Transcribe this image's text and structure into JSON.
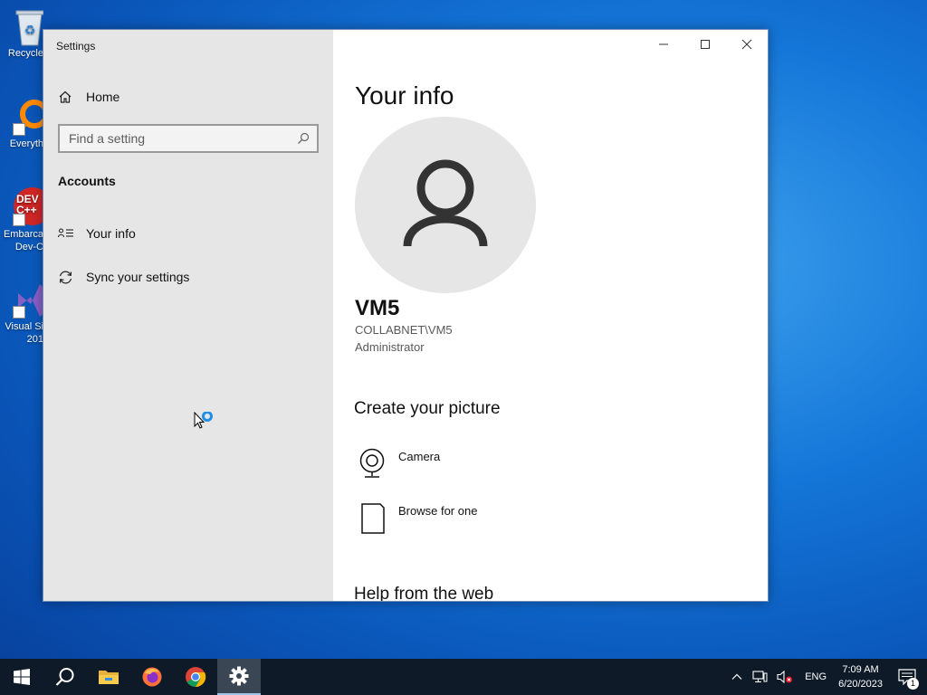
{
  "desktop": {
    "icons": [
      {
        "label": "Recycle",
        "icon": "recycle-bin-icon"
      },
      {
        "label": "Everyth",
        "icon": "everything-search-icon"
      },
      {
        "label": "Embarca",
        "label2": "Dev-C",
        "icon": "dev-cpp-icon"
      },
      {
        "label": "Visual Si",
        "label2": "201",
        "icon": "visual-studio-icon"
      }
    ],
    "devcpp_text": "DEV C++"
  },
  "window": {
    "title": "Settings",
    "controls": [
      "minimize-icon",
      "maximize-icon",
      "close-icon"
    ]
  },
  "nav": {
    "home_label": "Home",
    "search_placeholder": "Find a setting",
    "section_label": "Accounts",
    "items": [
      {
        "label": "Your info",
        "icon": "person-card-icon"
      },
      {
        "label": "Sync your settings",
        "icon": "sync-icon"
      }
    ]
  },
  "content": {
    "title": "Your info",
    "user_name": "VM5",
    "user_domain": "COLLABNET\\VM5",
    "user_role": "Administrator",
    "create_picture_header": "Create your picture",
    "options": [
      {
        "label": "Camera",
        "icon": "camera-icon"
      },
      {
        "label": "Browse for one",
        "icon": "document-icon"
      }
    ],
    "help_header": "Help from the web"
  },
  "taskbar": {
    "apps": [
      "start-icon",
      "search-icon",
      "file-explorer-icon",
      "firefox-icon",
      "chrome-icon",
      "settings-icon"
    ],
    "active_app": "settings-icon",
    "language": "ENG",
    "time": "7:09 AM",
    "date": "6/20/2023",
    "notification_count": "1"
  },
  "colors": {
    "nav_bg": "#e6e6e6",
    "taskbar_bg": "#0e1a27",
    "accent": "#0078d7"
  }
}
